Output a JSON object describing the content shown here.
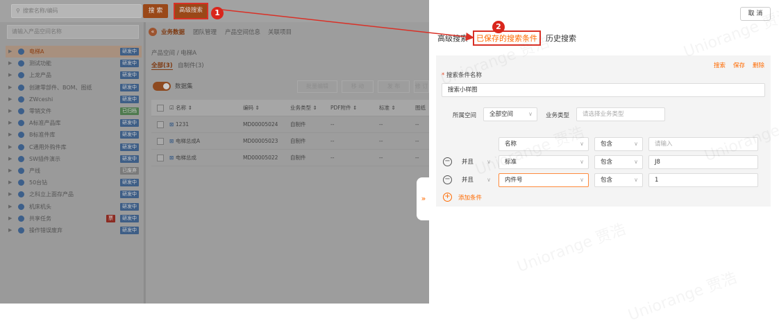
{
  "topbar": {
    "search_placeholder": "搜索名称/编码",
    "search_btn": "搜 索",
    "advanced_btn": "高级搜索"
  },
  "sidebar": {
    "filter_placeholder": "请输入产品空间名称",
    "items": [
      {
        "label": "电梯A",
        "tag": "研发中",
        "tag_type": "blue",
        "selected": true
      },
      {
        "label": "测试功能",
        "tag": "研发中",
        "tag_type": "blue"
      },
      {
        "label": "上龙产品",
        "tag": "研发中",
        "tag_type": "blue"
      },
      {
        "label": "创建零部件、BOM、图纸",
        "tag": "研发中",
        "tag_type": "blue"
      },
      {
        "label": "ZWceshi",
        "tag": "研发中",
        "tag_type": "blue"
      },
      {
        "label": "零销文件",
        "tag": "已归档",
        "tag_type": "green"
      },
      {
        "label": "A标准产品库",
        "tag": "研发中",
        "tag_type": "blue"
      },
      {
        "label": "B标准件库",
        "tag": "研发中",
        "tag_type": "blue"
      },
      {
        "label": "C通用外购件库",
        "tag": "研发中",
        "tag_type": "blue"
      },
      {
        "label": "SW插件演示",
        "tag": "研发中",
        "tag_type": "blue"
      },
      {
        "label": "产线",
        "tag": "已废弃",
        "tag_type": "grey"
      },
      {
        "label": "50台钻",
        "tag": "研发中",
        "tag_type": "blue"
      },
      {
        "label": "之科立上面存产品",
        "tag": "研发中",
        "tag_type": "blue"
      },
      {
        "label": "机床机头",
        "tag": "研发中",
        "tag_type": "blue"
      },
      {
        "label": "共享任务",
        "tag": "研发中",
        "tag_type": "blue",
        "extra_tag": "票"
      },
      {
        "label": "操作错误废弃",
        "tag": "研发中",
        "tag_type": "blue"
      }
    ]
  },
  "content": {
    "tabs": [
      "业务数据",
      "团队管理",
      "产品空间信息",
      "关联项目"
    ],
    "breadcrumb": "产品空间  /  电梯A",
    "subtabs": [
      "全部(3)",
      "自制件(3)"
    ],
    "toggle_label": "数据集",
    "buttons": [
      "批量编辑",
      "移 动",
      "发 布",
      "修 订"
    ],
    "columns": [
      "名称 ⇕",
      "编码 ⇕",
      "业务类型 ⇕",
      "PDF附件 ⇕",
      "标准 ⇕",
      "图纸"
    ],
    "rows": [
      {
        "name": "1231",
        "code": "MD00005024",
        "type": "自制件",
        "pdf": "--",
        "std": "--",
        "drw": "--"
      },
      {
        "name": "电梯总成A",
        "code": "MD00005023",
        "type": "自制件",
        "pdf": "--",
        "std": "--",
        "drw": "--"
      },
      {
        "name": "电梯总成",
        "code": "MD00005022",
        "type": "自制件",
        "pdf": "--",
        "std": "--",
        "drw": "--"
      }
    ]
  },
  "panel": {
    "cancel": "取 消",
    "tabs": [
      "高级搜索",
      "已保存的搜索条件",
      "历史搜索"
    ],
    "actions": [
      "搜索",
      "保存",
      "删除"
    ],
    "name_label": "搜索条件名称",
    "name_value": "搜索小样图",
    "space_label": "所属空间",
    "space_value": "全部空间",
    "biz_label": "业务类型",
    "biz_placeholder": "请选择业务类型",
    "conditions": [
      {
        "logic": "",
        "field": "名称",
        "op": "包含",
        "value": "",
        "value_placeholder": "请输入"
      },
      {
        "logic": "并且",
        "field": "标准",
        "op": "包含",
        "value": "J8"
      },
      {
        "logic": "并且",
        "field": "内件号",
        "op": "包含",
        "value": "1"
      }
    ],
    "add_condition": "添加条件"
  },
  "annotations": {
    "step1": "1",
    "step2": "2"
  },
  "watermark": "Uniorange 贾浩",
  "colors": {
    "accent": "#ff6a00",
    "annotation_red": "#d93026",
    "brand_blue": "#3e5e86"
  }
}
